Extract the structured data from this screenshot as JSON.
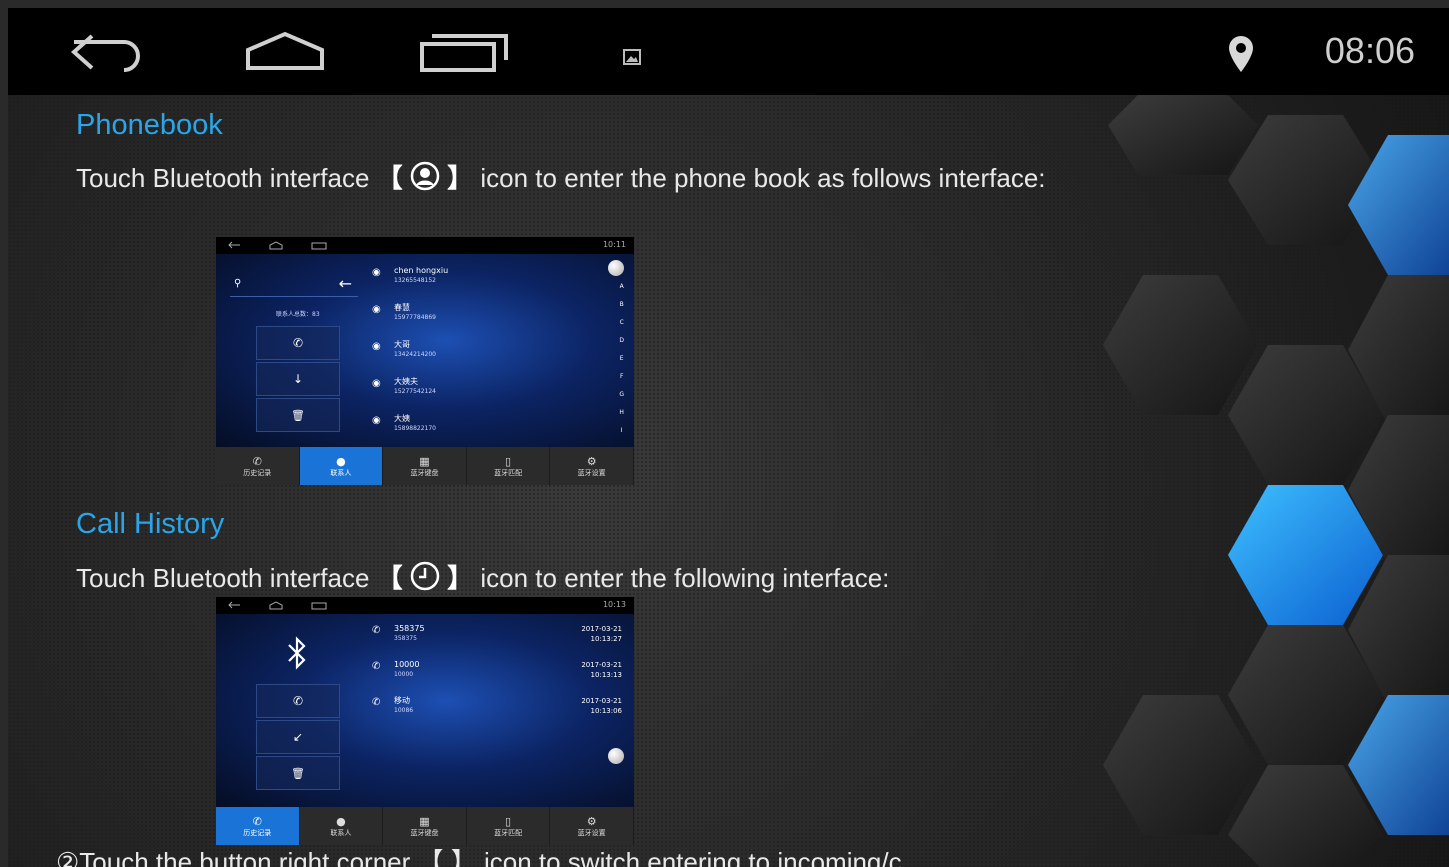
{
  "statusbar": {
    "clock": "08:06"
  },
  "phonebook": {
    "heading": "Phonebook",
    "text_before": "Touch Bluetooth interface ",
    "text_after": " icon to enter the phone book as follows interface:",
    "bracket_open": "【",
    "bracket_close": "】",
    "mini": {
      "clock": "10:11",
      "contacts_count_label": "联系人总数：83",
      "contacts": [
        {
          "name": "chen hongxiu",
          "number": "13265548152"
        },
        {
          "name": "春慧",
          "number": "15977784869"
        },
        {
          "name": "大哥",
          "number": "13424214200"
        },
        {
          "name": "大姨夫",
          "number": "15277542124"
        },
        {
          "name": "大姨",
          "number": "15898822170"
        }
      ],
      "alphabet": [
        "A",
        "B",
        "C",
        "D",
        "E",
        "F",
        "G",
        "H",
        "I"
      ]
    }
  },
  "callhistory": {
    "heading": "Call History",
    "text_before": "Touch Bluetooth interface ",
    "text_after": " icon to enter the following interface:",
    "bracket_open": "【",
    "bracket_close": "】",
    "mini": {
      "clock": "10:13",
      "calls": [
        {
          "name": "358375",
          "number": "358375",
          "date": "2017-03-21",
          "time": "10:13:27"
        },
        {
          "name": "10000",
          "number": "10000",
          "date": "2017-03-21",
          "time": "10:13:13"
        },
        {
          "name": "移动",
          "number": "10086",
          "date": "2017-03-21",
          "time": "10:13:06"
        }
      ]
    }
  },
  "tabs": [
    "历史记录",
    "联系人",
    "蓝牙键盘",
    "蓝牙匹配",
    "蓝牙设置"
  ],
  "bottom_text": "②Touch the button right corner 【 】 icon to switch entering to incoming/c"
}
